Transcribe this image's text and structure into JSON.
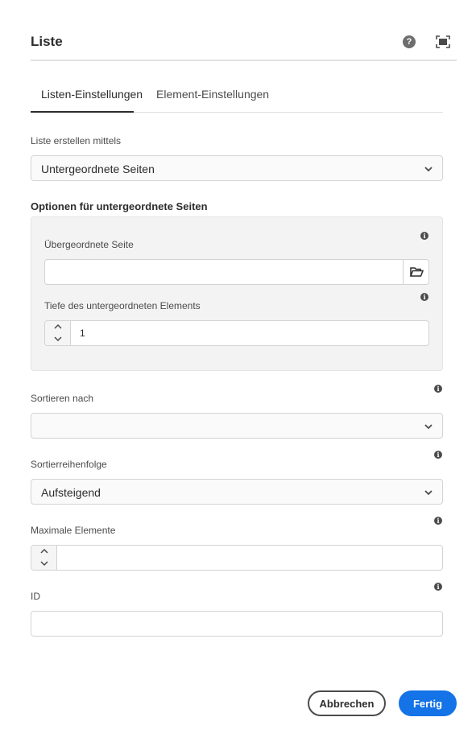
{
  "dialog": {
    "title": "Liste",
    "help_icon": "help-circle-icon",
    "help_glyph": "?",
    "fullscreen_icon": "fullscreen-icon"
  },
  "tabs": [
    {
      "label": "Listen-Einstellungen",
      "active": true
    },
    {
      "label": "Element-Einstellungen",
      "active": false
    }
  ],
  "build_list": {
    "label": "Liste erstellen mittels",
    "value": "Untergeordnete Seiten"
  },
  "child_options": {
    "title": "Optionen für untergeordnete Seiten",
    "parent_page": {
      "label": "Übergeordnete Seite",
      "value": "",
      "browse_icon": "folder-open-icon"
    },
    "child_depth": {
      "label": "Tiefe des untergeordneten Elements",
      "value": "1"
    }
  },
  "order_by": {
    "label": "Sortieren nach",
    "value": ""
  },
  "sort_order": {
    "label": "Sortierreihenfolge",
    "value": "Aufsteigend"
  },
  "max_items": {
    "label": "Maximale Elemente",
    "value": ""
  },
  "id_field": {
    "label": "ID",
    "value": ""
  },
  "info_glyph": "i",
  "footer": {
    "cancel_label": "Abbrechen",
    "done_label": "Fertig"
  },
  "colors": {
    "accent": "#1473e6",
    "text": "#2c2c2c",
    "panel_bg": "#f3f3f3"
  }
}
